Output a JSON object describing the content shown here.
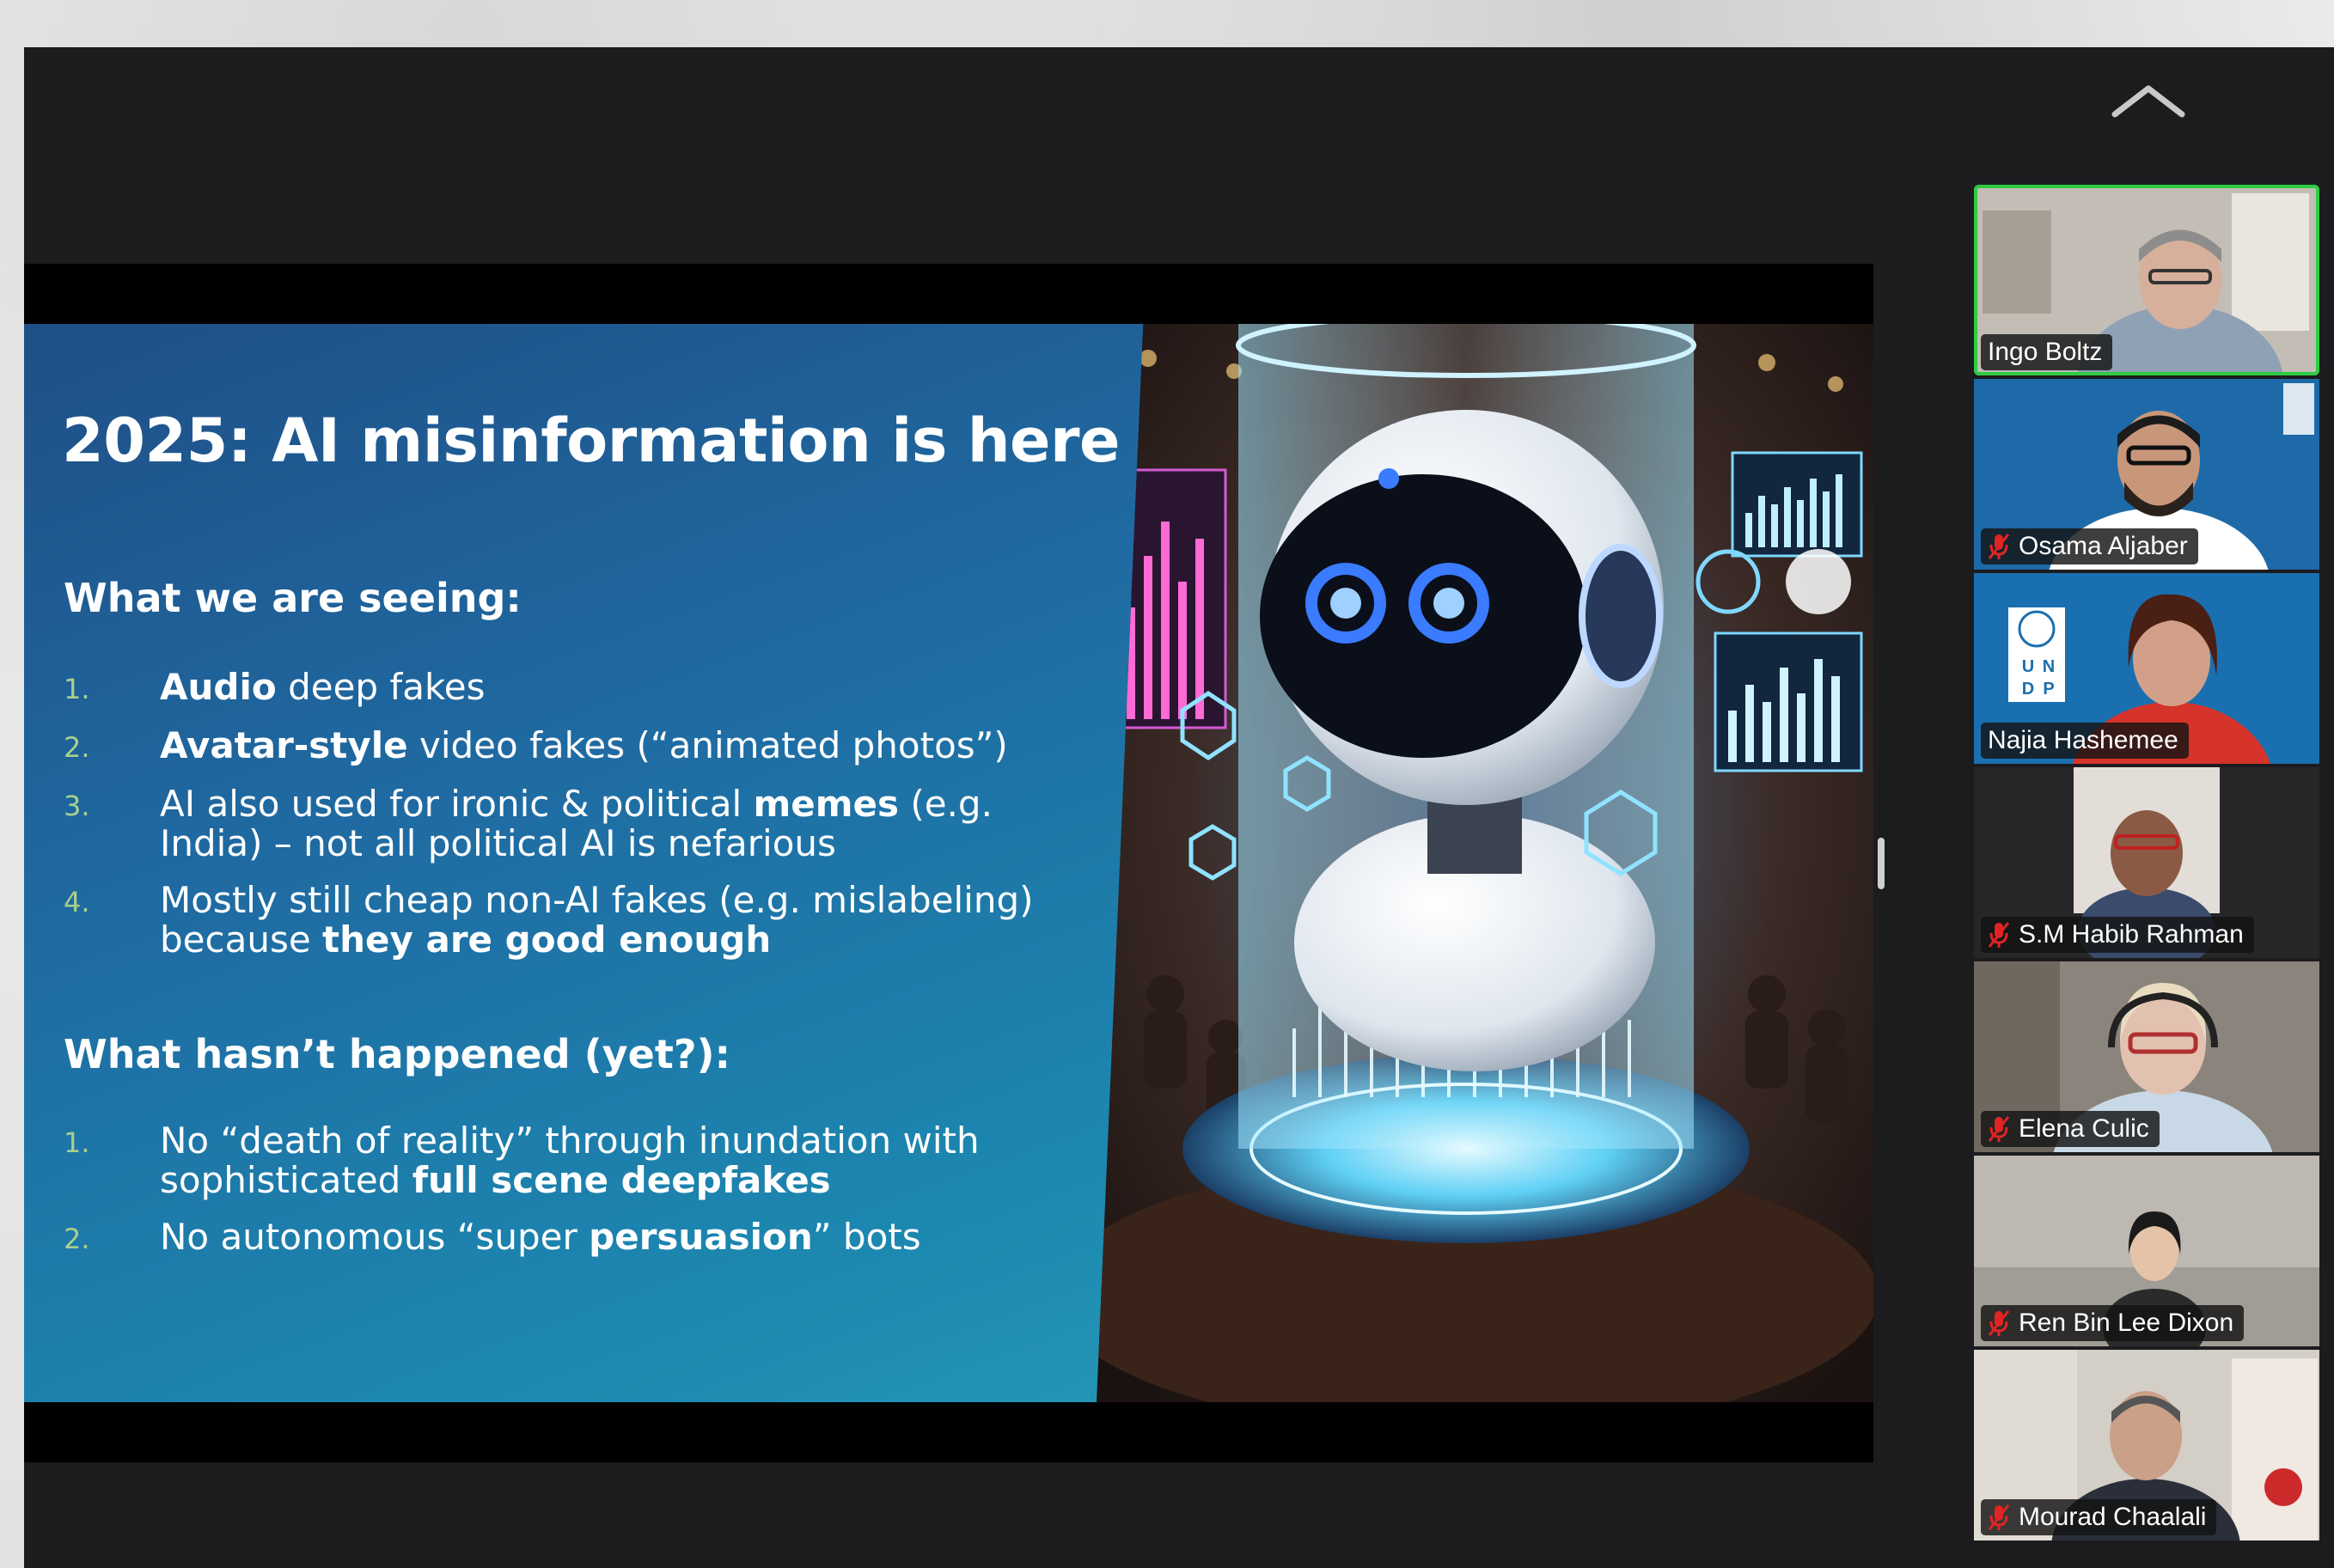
{
  "slide": {
    "title": "2025: AI misinformation is here",
    "seeing_heading": "What we are seeing:",
    "seeing_items": [
      {
        "num": "1.",
        "pre": "",
        "bold": "Audio",
        "post": " deep fakes",
        "pre2": "",
        "bold2": "",
        "post2": ""
      },
      {
        "num": "2.",
        "pre": "",
        "bold": "Avatar-style",
        "post": " video fakes (“animated photos”)",
        "pre2": "",
        "bold2": "",
        "post2": ""
      },
      {
        "num": "3.",
        "pre": "AI also used for ironic & political ",
        "bold": "memes",
        "post": " (e.g. India) – not all political AI is nefarious",
        "pre2": "",
        "bold2": "",
        "post2": ""
      },
      {
        "num": "4.",
        "pre": "Mostly still cheap non-AI fakes (e.g. mislabeling) because ",
        "bold": "they are good enough",
        "post": "",
        "pre2": "",
        "bold2": "",
        "post2": ""
      }
    ],
    "not_happened_heading": "What hasn’t happened (yet?):",
    "not_happened_items": [
      {
        "num": "1.",
        "pre": "No “death of reality” through inundation with sophisticated ",
        "bold": "full scene deepfakes",
        "post": ""
      },
      {
        "num": "2.",
        "pre": "No autonomous “super ",
        "bold": "persuasion",
        "post": "” bots"
      }
    ]
  },
  "participants": [
    {
      "name": "Ingo Boltz",
      "muted": false,
      "speaking": true,
      "bg": "#b9b3ab"
    },
    {
      "name": "Osama Aljaber",
      "muted": true,
      "speaking": false,
      "bg": "#1e6aa8"
    },
    {
      "name": "Najia Hashemee",
      "muted": false,
      "speaking": false,
      "bg": "#1a6fb0"
    },
    {
      "name": "S.M Habib Rahman",
      "muted": true,
      "speaking": false,
      "bg": "#262628"
    },
    {
      "name": "Elena Culic",
      "muted": true,
      "speaking": false,
      "bg": "#8a847c"
    },
    {
      "name": "Ren Bin Lee Dixon",
      "muted": true,
      "speaking": false,
      "bg": "#9a9690"
    },
    {
      "name": "Mourad Chaalali",
      "muted": true,
      "speaking": false,
      "bg": "#cfcac2"
    }
  ],
  "un_logo_letters": [
    "U",
    "N",
    "D",
    "P"
  ],
  "colors": {
    "speaking_border": "#2ecc40",
    "muted_icon": "#e02424",
    "bullet_number": "#a8d08d",
    "window_bg": "#1c1c1e"
  },
  "icons": [
    "chevron-up-icon",
    "mic-muted-icon"
  ]
}
